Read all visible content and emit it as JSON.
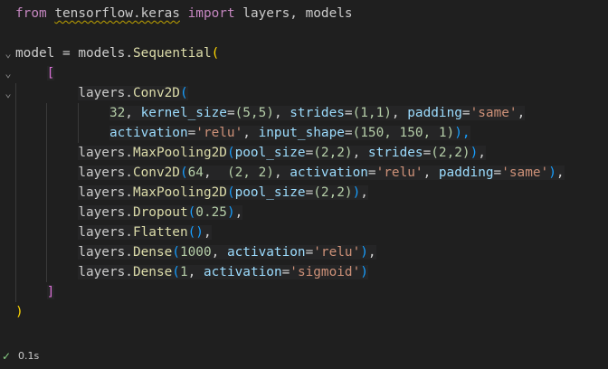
{
  "editor": {
    "line1": {
      "kw_from": "from",
      "module": "tensorflow.keras",
      "kw_import": "import",
      "rest": "layers, models"
    },
    "line3": {
      "var": "model",
      "eq": "=",
      "obj": "models.",
      "fn": "Sequential",
      "paren": "("
    },
    "line4": {
      "bracket": "["
    },
    "line5": {
      "obj": "layers.",
      "fn": "Conv2D",
      "paren": "("
    },
    "line6": {
      "n1": "32",
      "p1": "kernel_size",
      "v1": "(5,5)",
      "p2": "strides",
      "v2": "(1,1)",
      "p3": "padding",
      "s3": "'same'"
    },
    "line7": {
      "p1": "activation",
      "s1": "'relu'",
      "p2": "input_shape",
      "v2": "(150, 150, 1)",
      "close": "),"
    },
    "line8": {
      "obj": "layers.",
      "fn": "MaxPooling2D",
      "p1": "pool_size",
      "v1": "(2,2)",
      "p2": "strides",
      "v2": "(2,2)"
    },
    "line9": {
      "obj": "layers.",
      "fn": "Conv2D",
      "n1": "64",
      "v2": "(2, 2)",
      "p3": "activation",
      "s3": "'relu'",
      "p4": "padding",
      "s4": "'same'"
    },
    "line10": {
      "obj": "layers.",
      "fn": "MaxPooling2D",
      "p1": "pool_size",
      "v1": "(2,2)"
    },
    "line11": {
      "obj": "layers.",
      "fn": "Dropout",
      "n1": "0.25"
    },
    "line12": {
      "obj": "layers.",
      "fn": "Flatten",
      "args": "()"
    },
    "line13": {
      "obj": "layers.",
      "fn": "Dense",
      "n1": "1000",
      "p2": "activation",
      "s2": "'relu'"
    },
    "line14": {
      "obj": "layers.",
      "fn": "Dense",
      "n1": "1",
      "p2": "activation",
      "s2": "'sigmoid'"
    },
    "line15": {
      "bracket": "]"
    },
    "line16": {
      "paren": ")"
    }
  },
  "fold_icon": "chevron-down-icon",
  "status": {
    "check_icon": "check-icon",
    "elapsed": "0.1s"
  },
  "colors": {
    "background": "#1f1f1f",
    "keyword": "#c586c0",
    "function": "#dcdcaa",
    "string": "#ce9178",
    "number": "#b5cea8",
    "parameter": "#9cdcfe",
    "bracket_level1": "#ffd700",
    "bracket_level2": "#da70d6",
    "bracket_level3": "#179fff",
    "success": "#89d185"
  }
}
